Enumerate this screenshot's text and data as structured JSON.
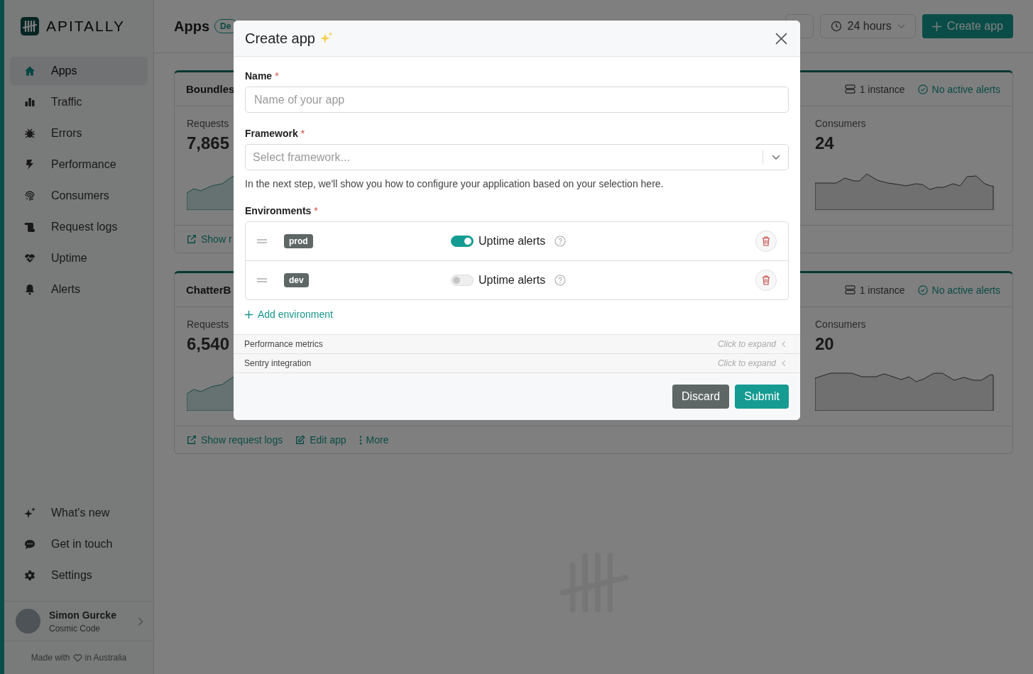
{
  "sidebar": {
    "brand": "APITALLY",
    "nav": [
      {
        "label": "Apps",
        "selected": true
      },
      {
        "label": "Traffic",
        "selected": false
      },
      {
        "label": "Errors",
        "selected": false
      },
      {
        "label": "Performance",
        "selected": false
      },
      {
        "label": "Consumers",
        "selected": false
      },
      {
        "label": "Request logs",
        "selected": false
      },
      {
        "label": "Uptime",
        "selected": false
      },
      {
        "label": "Alerts",
        "selected": false
      }
    ],
    "bottom_nav": [
      {
        "label": "What's new"
      },
      {
        "label": "Get in touch"
      },
      {
        "label": "Settings"
      }
    ],
    "user": {
      "name": "Simon Gurcke",
      "organization": "Cosmic Code"
    },
    "footer": {
      "before": "Made with",
      "after": "in Australia"
    }
  },
  "header": {
    "title": "Apps",
    "badge": "De",
    "period": "24 hours",
    "create_button": "Create app"
  },
  "apps": [
    {
      "name": "Boundles",
      "instances": "1 instance",
      "alerts": "No active alerts",
      "metrics": [
        {
          "label": "Requests",
          "value": "7,865"
        },
        {
          "label": "Consumers",
          "value": "24"
        }
      ],
      "actions": [
        {
          "kind": "link",
          "label": "Show r"
        }
      ]
    },
    {
      "name": "ChatterB",
      "instances": "1 instance",
      "alerts": "No active alerts",
      "metrics": [
        {
          "label": "Requests",
          "value": "6,540"
        },
        {
          "label": "Consumers",
          "value": "20"
        }
      ],
      "actions": [
        {
          "kind": "link",
          "label": "Show request logs"
        },
        {
          "kind": "edit",
          "label": "Edit app"
        },
        {
          "kind": "more",
          "label": "More"
        }
      ]
    }
  ],
  "modal": {
    "title": "Create app",
    "name_field": {
      "label": "Name",
      "mark": "*",
      "placeholder": "Name of your app"
    },
    "framework_field": {
      "label": "Framework",
      "mark": "*",
      "placeholder": "Select framework...",
      "help": "In the next step, we'll show you how to configure your application based on your selection here."
    },
    "environments": {
      "label": "Environments",
      "mark": "*",
      "items": [
        {
          "name": "prod",
          "alerts_on": true,
          "alerts_label": "Uptime alerts"
        },
        {
          "name": "dev",
          "alerts_on": false,
          "alerts_label": "Uptime alerts"
        }
      ],
      "add_link": "Add environment"
    },
    "sections": [
      {
        "label": "Performance metrics",
        "hint": "Click to expand",
        "expanded": false
      },
      {
        "label": "Sentry integration",
        "hint": "Click to expand",
        "expanded": false
      }
    ],
    "buttons": {
      "discard": "Discard",
      "submit": "Submit"
    }
  }
}
